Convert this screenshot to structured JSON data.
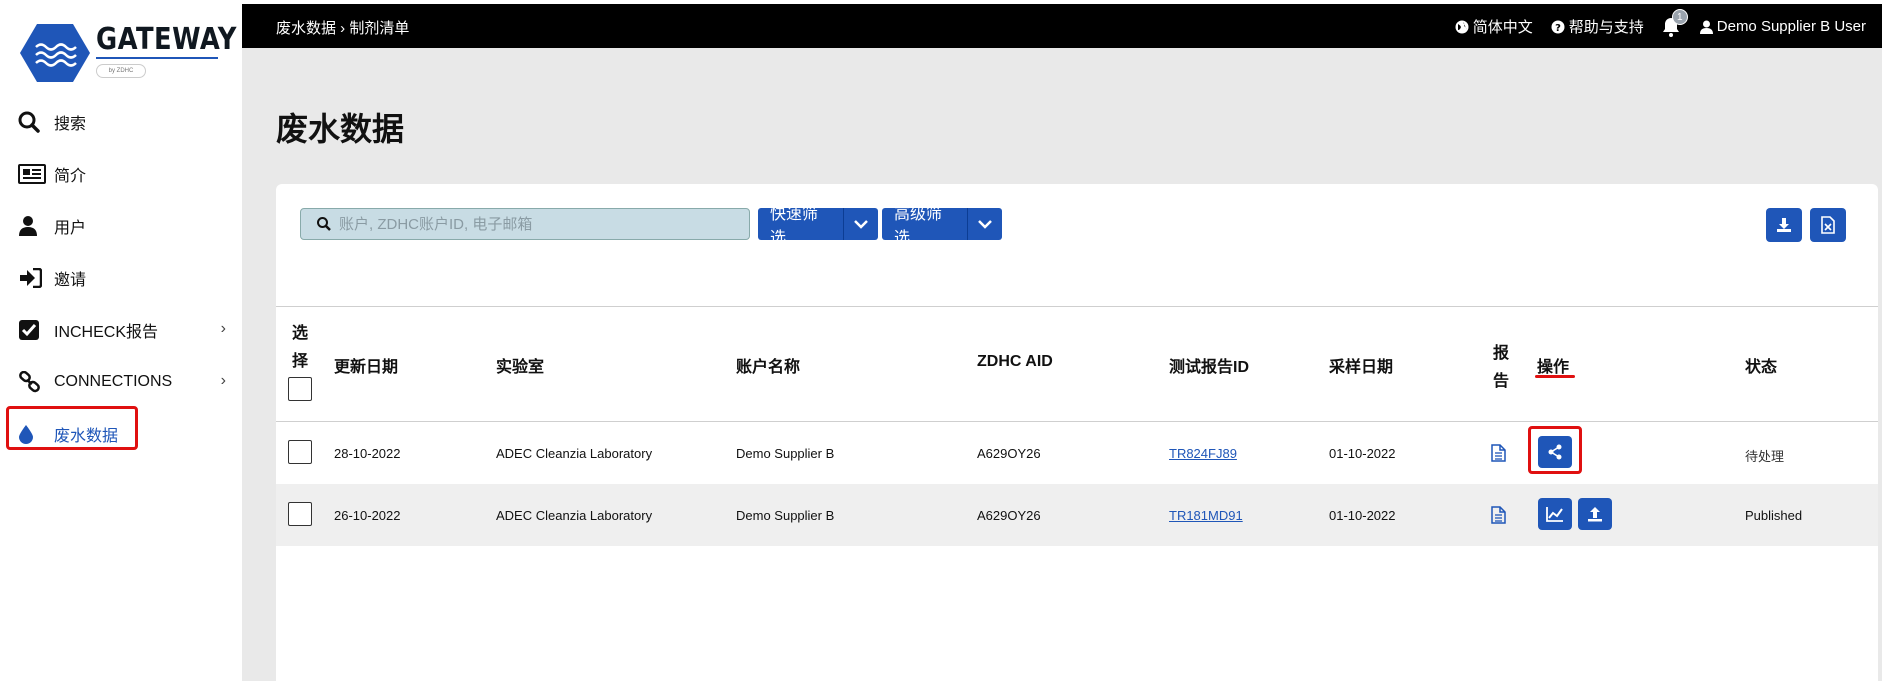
{
  "brand": {
    "name": "GATEWAY",
    "sub": "by ZDHC"
  },
  "sidebar": {
    "items": [
      {
        "label": "搜索",
        "icon": "search-icon"
      },
      {
        "label": "简介",
        "icon": "newspaper-icon"
      },
      {
        "label": "用户",
        "icon": "user-icon"
      },
      {
        "label": "邀请",
        "icon": "sign-in-icon"
      },
      {
        "label": "INCHECK报告",
        "icon": "check-square-icon",
        "chevron": "›"
      },
      {
        "label": "CONNECTIONS",
        "icon": "link-icon",
        "chevron": "›"
      },
      {
        "label": "废水数据",
        "icon": "water-drop-icon",
        "active": true
      }
    ]
  },
  "topbar": {
    "breadcrumb": "废水数据 › 制剂清单",
    "language": "简体中文",
    "help": "帮助与支持",
    "notifications_count": "1",
    "user": "Demo Supplier B User"
  },
  "page": {
    "title": "废水数据"
  },
  "toolbar": {
    "search_placeholder": "账户, ZDHC账户ID, 电子邮箱",
    "quick_filter": "快速筛选",
    "advanced_filter": "高级筛选"
  },
  "table": {
    "headers": {
      "select_line1": "选",
      "select_line2": "择",
      "updated": "更新日期",
      "lab": "实验室",
      "account": "账户名称",
      "aid": "ZDHC AID",
      "report_id": "测试报告ID",
      "sample_date": "采样日期",
      "report_line1": "报",
      "report_line2": "告",
      "actions": "操作",
      "status": "状态"
    },
    "rows": [
      {
        "updated": "28-10-2022",
        "lab": "ADEC Cleanzia Laboratory",
        "account": "Demo Supplier B",
        "aid": "A629OY26",
        "report_id": "TR824FJ89",
        "sample_date": "01-10-2022",
        "status": "待处理"
      },
      {
        "updated": "26-10-2022",
        "lab": "ADEC Cleanzia Laboratory",
        "account": "Demo Supplier B",
        "aid": "A629OY26",
        "report_id": "TR181MD91",
        "sample_date": "01-10-2022",
        "status": "Published"
      }
    ]
  },
  "colors": {
    "primary": "#1f56b8",
    "highlight": "#e01010",
    "topbar": "#000000",
    "background": "#e9e9e9"
  }
}
